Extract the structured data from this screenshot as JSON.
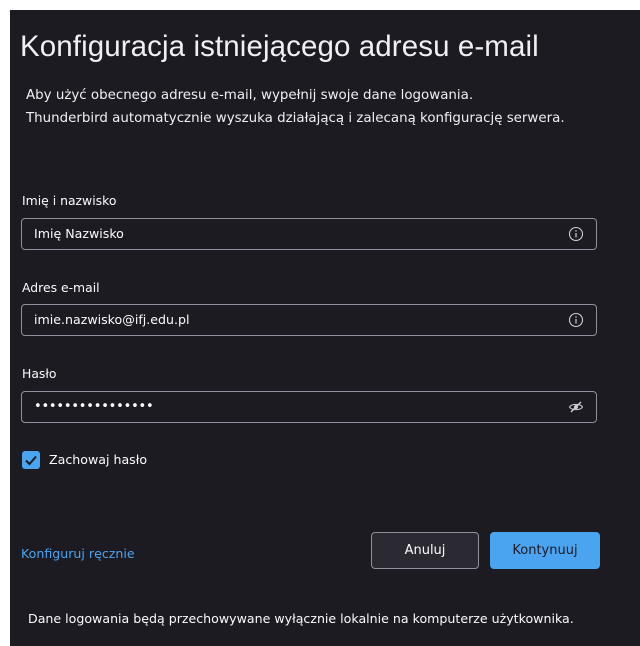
{
  "dialog": {
    "title": "Konfiguracja istniejącego adresu e-mail",
    "description_line1": "Aby użyć obecnego adresu e-mail, wypełnij swoje dane logowania.",
    "description_line2": "Thunderbird automatycznie wyszuka działającą i zalecaną konfigurację serwera."
  },
  "fields": {
    "name": {
      "label": "Imię i nazwisko",
      "value": "Imię Nazwisko",
      "icon": "info-icon"
    },
    "email": {
      "label": "Adres e-mail",
      "value": "imie.nazwisko@ifj.edu.pl",
      "icon": "info-icon"
    },
    "password": {
      "label": "Hasło",
      "value": "••••••••••••••••",
      "icon": "eye-slash-icon"
    }
  },
  "remember_password": {
    "label": "Zachowaj hasło",
    "checked": true
  },
  "actions": {
    "manual_config": "Konfiguruj ręcznie",
    "cancel": "Anuluj",
    "continue": "Kontynuuj"
  },
  "footer": {
    "note": "Dane logowania będą przechowywane wyłącznie lokalnie na komputerze użytkownika."
  },
  "colors": {
    "background": "#1c1b22",
    "accent": "#4ba4f0",
    "field_border": "#8f8f9d",
    "text": "#fbfbfe"
  }
}
